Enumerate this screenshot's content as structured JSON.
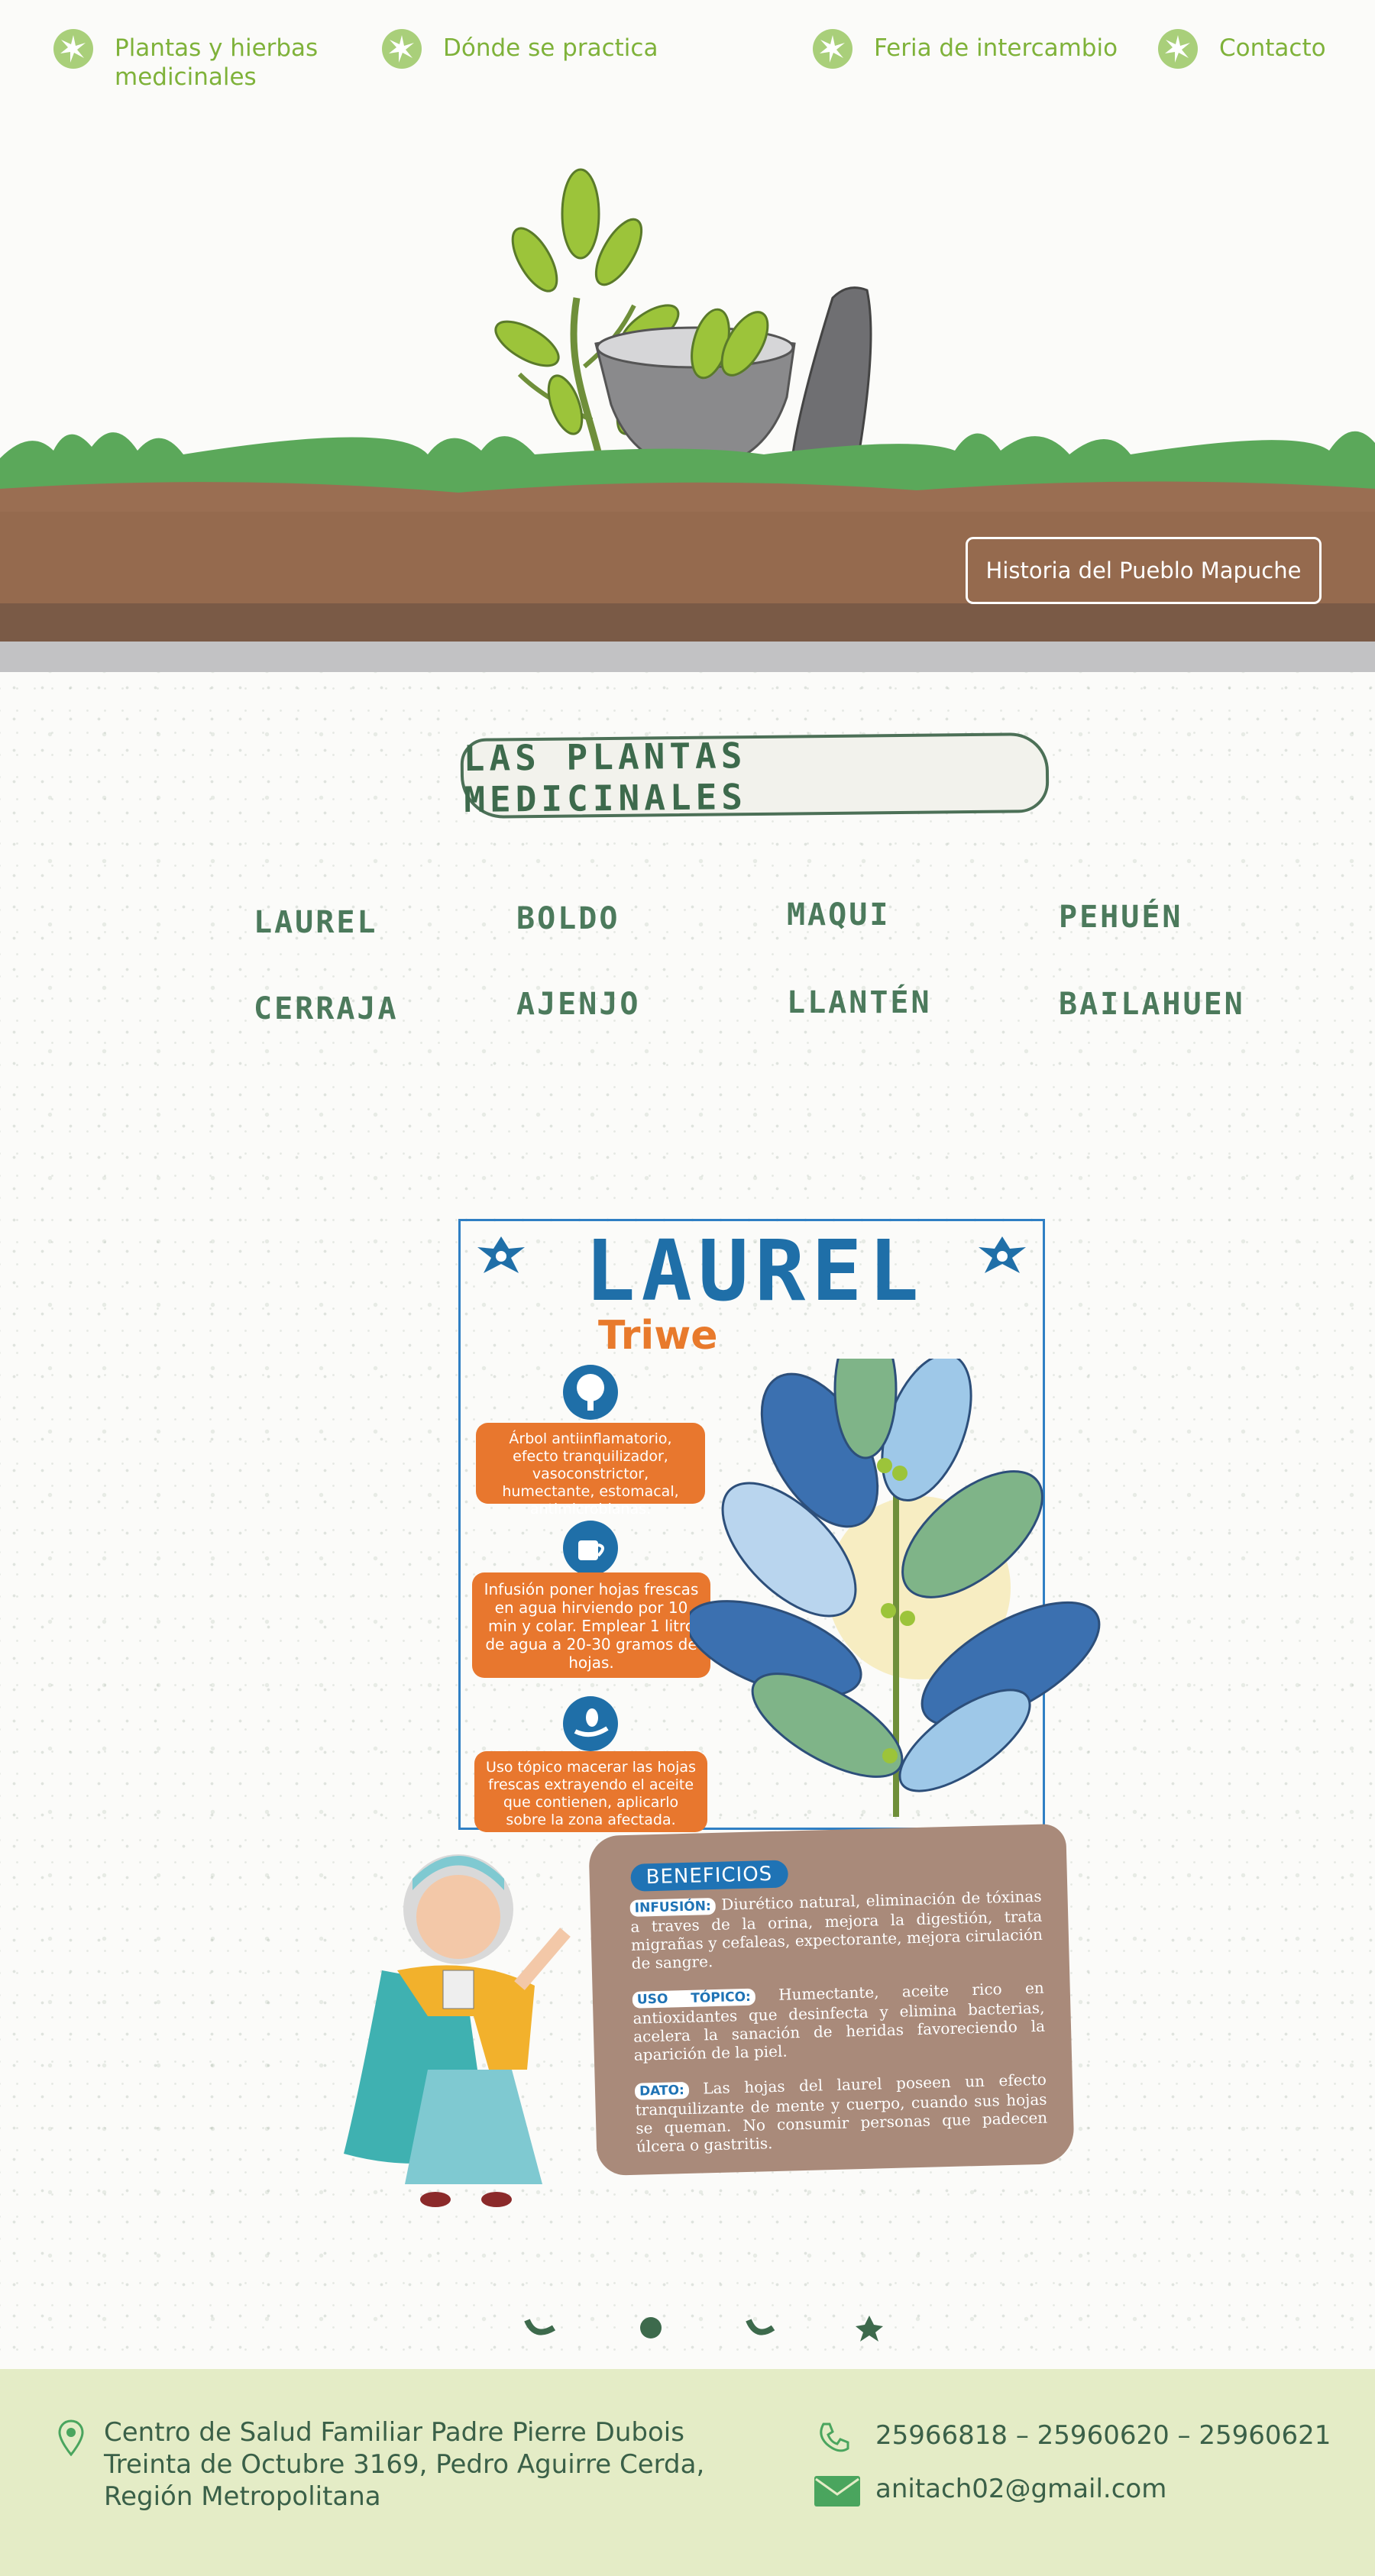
{
  "nav": {
    "items": [
      {
        "label_line1": "Plantas y hierbas",
        "label_line2": "medicinales"
      },
      {
        "label_line1": "Dónde se practica",
        "label_line2": ""
      },
      {
        "label_line1": "Feria de intercambio",
        "label_line2": ""
      },
      {
        "label_line1": "Contacto",
        "label_line2": ""
      }
    ]
  },
  "hero": {
    "button_label": "Historia del Pueblo Mapuche"
  },
  "section": {
    "title": "Las plantas medicinales"
  },
  "plants": {
    "row1": [
      "Laurel",
      "Boldo",
      "Maqui",
      "Pehuén"
    ],
    "row2": [
      "Cerraja",
      "Ajenjo",
      "Llantén",
      "Bailahuen"
    ]
  },
  "card": {
    "title": "LAUREL",
    "subtitle": "Triwe",
    "box1": "Árbol antiinflamatorio, efecto tranquilizador, vasoconstrictor, humectante, estomacal, antimicrobianas.",
    "box2": "Infusión poner hojas frescas en agua hirviendo por 10 min y colar. Emplear 1 litro de agua a 20-30 gramos de hojas.",
    "box3": "Uso tópico macerar las hojas frescas extrayendo el aceite que contienen, aplicarlo sobre la zona afectada.",
    "benefits_title": "BENEFICIOS",
    "b1_tag": "INFUSIÓN:",
    "b1_text": "Diurético natural, eliminación de tóxinas a traves de la orina, mejora la digestión, trata migrañas y cefaleas, expectorante, mejora cirulación de sangre.",
    "b2_tag": "USO TÓPICO:",
    "b2_text": "Humectante, aceite rico en antioxidantes que desinfecta y elimina bacterias, acelera la sanación de heridas favoreciendo la aparición de la piel.",
    "b3_tag": "DATO:",
    "b3_text": "Las hojas del laurel poseen un efecto tranquilizante de mente y cuerpo, cuando sus hojas se queman. No consumir personas que padecen úlcera o gastritis."
  },
  "footer": {
    "address_line1": "Centro de Salud Familiar Padre Pierre Dubois",
    "address_line2": "Treinta de Octubre 3169, Pedro Aguirre Cerda,",
    "address_line3": "Región Metropolitana",
    "phones": "25966818 – 25960620 – 25960621",
    "email": "anitach02@gmail.com"
  },
  "colors": {
    "nav_green": "#7fb23a",
    "title_green": "#3d6a4c",
    "laurel_blue": "#1f6fa8",
    "orange": "#e8772e",
    "footer_bg": "#e4ecc6"
  },
  "icons": [
    "leaf-badge-icon",
    "location-pin-icon",
    "phone-icon",
    "mail-icon",
    "tree-icon",
    "cup-icon",
    "hand-plant-icon",
    "bird-icon"
  ]
}
